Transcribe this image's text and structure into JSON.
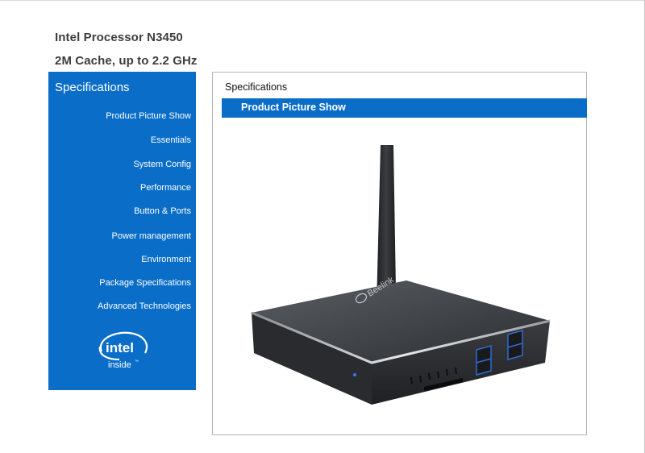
{
  "header": {
    "title_line1": "Intel Processor N3450",
    "title_line2": "2M Cache, up to 2.2 GHz"
  },
  "sidebar": {
    "heading": "Specifications",
    "items": [
      {
        "label": "Product Picture Show"
      },
      {
        "label": "Essentials"
      },
      {
        "label": "System Config"
      },
      {
        "label": "Performance"
      },
      {
        "label": "Button & Ports"
      },
      {
        "label": "Power management"
      },
      {
        "label": "Environment"
      },
      {
        "label": "Package Specifications"
      },
      {
        "label": "Advanced Technologies"
      }
    ],
    "logo": {
      "word": "intel",
      "tagline": "inside",
      "tm": "™"
    }
  },
  "panel": {
    "heading": "Specifications",
    "active_tab": "Product Picture Show",
    "product_brand": "Beelink"
  },
  "colors": {
    "accent_blue": "#0a6ec8",
    "title_gray": "#3d3d3d"
  }
}
